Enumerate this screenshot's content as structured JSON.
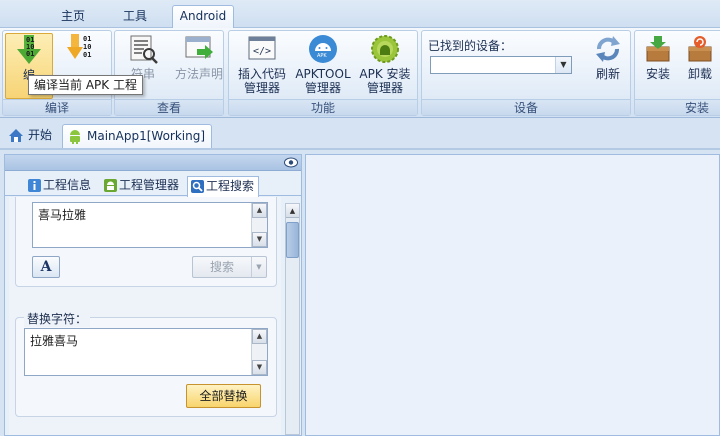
{
  "menu": {
    "tabs": [
      "主页",
      "工具",
      "Android"
    ],
    "active": "Android"
  },
  "ribbon": {
    "compile": {
      "label": "编译",
      "buttons": [
        {
          "label": "编",
          "icon": "compile-arrow-icon"
        },
        {
          "label": "",
          "icon": "decompile-arrow-icon"
        }
      ]
    },
    "view": {
      "label": "查看",
      "buttons": [
        {
          "label": "符串",
          "icon": "string-search-icon"
        },
        {
          "label": "方法声明",
          "icon": "method-declaration-icon"
        }
      ]
    },
    "feature": {
      "label": "功能",
      "buttons": [
        {
          "label": "插入代码管理器",
          "icon": "code-insert-icon"
        },
        {
          "label": "APKTOOL管理器",
          "icon": "apktool-icon"
        },
        {
          "label": "APK 安装管理器",
          "icon": "apk-install-icon"
        }
      ]
    },
    "device": {
      "label": "设备",
      "found_label": "已找到的设备：",
      "select_value": "",
      "refresh_label": "刷新"
    },
    "install": {
      "label": "安装",
      "buttons": [
        {
          "label": "安装",
          "icon": "install-icon"
        },
        {
          "label": "卸载",
          "icon": "uninstall-icon"
        }
      ]
    }
  },
  "tooltip": "编译当前 APK 工程",
  "doc_tabs": [
    {
      "label": "开始",
      "icon": "home-icon"
    },
    {
      "label": "MainApp1[Working]",
      "icon": "android-icon"
    }
  ],
  "panel": {
    "tabs": [
      {
        "label": "工程信息",
        "icon": "info-icon"
      },
      {
        "label": "工程管理器",
        "icon": "android-icon"
      },
      {
        "label": "工程搜索",
        "icon": "search-icon"
      }
    ],
    "search_text": "喜马拉雅",
    "font_button": "A",
    "search_button": "搜索",
    "replace_label": "替换字符：",
    "replace_text": "拉雅喜马",
    "replace_all_button": "全部替换"
  },
  "colors": {
    "accent": "#f8d46c",
    "frame": "#9fbbe0",
    "panel_bg": "#e7eff9"
  }
}
